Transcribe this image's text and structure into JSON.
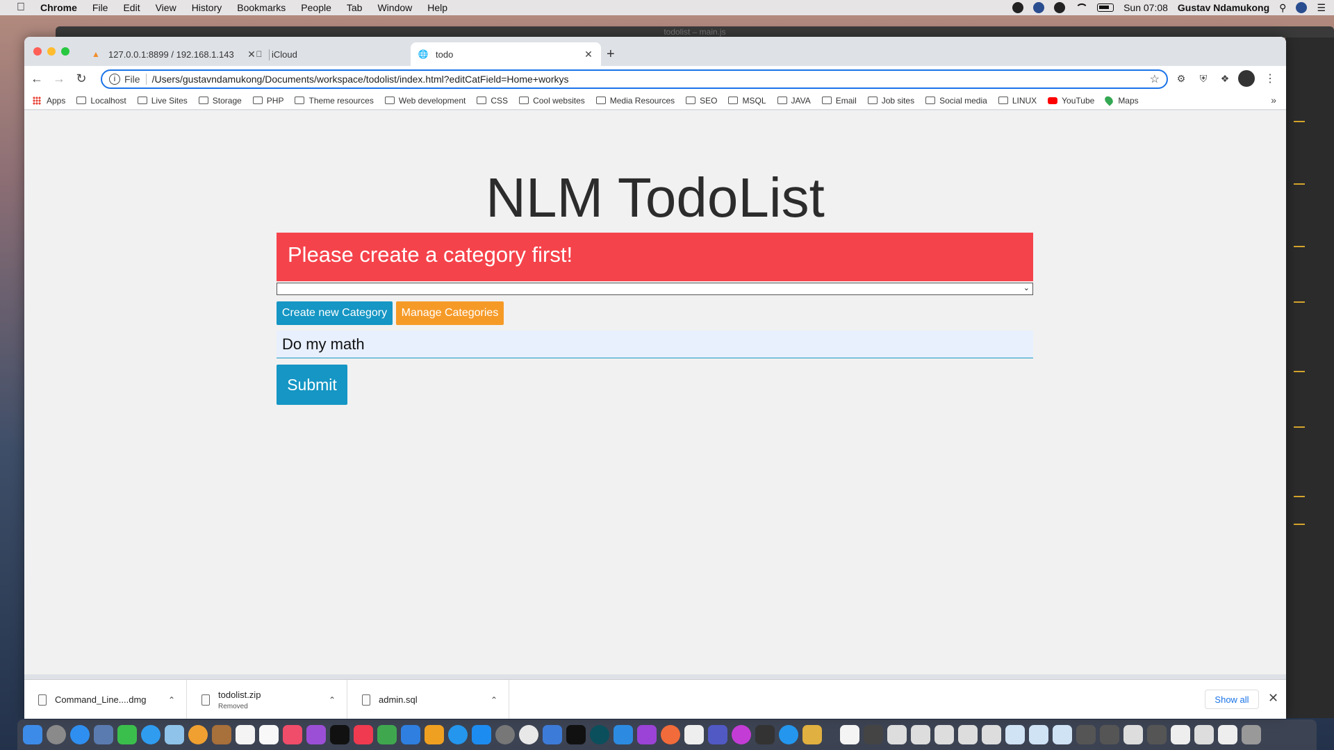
{
  "menubar": {
    "app_name": "Chrome",
    "menus": [
      "File",
      "Edit",
      "View",
      "History",
      "Bookmarks",
      "People",
      "Tab",
      "Window",
      "Help"
    ],
    "clock": "Sun 07:08",
    "user": "Gustav Ndamukong"
  },
  "background_window": {
    "title": "todolist – main.js"
  },
  "browser": {
    "tabs": [
      {
        "title": "127.0.0.1:8899 / 192.168.1.143",
        "icon": "phpmyadmin-icon"
      },
      {
        "title": "iCloud",
        "icon": "apple-icon"
      },
      {
        "title": "todo",
        "icon": "globe-icon",
        "active": true
      }
    ],
    "address": {
      "scheme_label": "File",
      "url": "/Users/gustavndamukong/Documents/workspace/todolist/index.html?editCatField=Home+workys"
    },
    "bookmarks": [
      {
        "label": "Apps",
        "icon": "apps-grid-icon"
      },
      {
        "label": "Localhost",
        "icon": "folder-icon"
      },
      {
        "label": "Live Sites",
        "icon": "folder-icon"
      },
      {
        "label": "Storage",
        "icon": "folder-icon"
      },
      {
        "label": "PHP",
        "icon": "folder-icon"
      },
      {
        "label": "Theme resources",
        "icon": "folder-icon"
      },
      {
        "label": "Web development",
        "icon": "folder-icon"
      },
      {
        "label": "CSS",
        "icon": "folder-icon"
      },
      {
        "label": "Cool websites",
        "icon": "folder-icon"
      },
      {
        "label": "Media Resources",
        "icon": "folder-icon"
      },
      {
        "label": "SEO",
        "icon": "folder-icon"
      },
      {
        "label": "MSQL",
        "icon": "folder-icon"
      },
      {
        "label": "JAVA",
        "icon": "folder-icon"
      },
      {
        "label": "Email",
        "icon": "folder-icon"
      },
      {
        "label": "Job sites",
        "icon": "folder-icon"
      },
      {
        "label": "Social media",
        "icon": "folder-icon"
      },
      {
        "label": "LINUX",
        "icon": "folder-icon"
      },
      {
        "label": "YouTube",
        "icon": "youtube-icon"
      },
      {
        "label": "Maps",
        "icon": "maps-icon"
      }
    ],
    "more_symbol": "»"
  },
  "page": {
    "title": "NLM TodoList",
    "alert": "Please create a category first!",
    "select_value": "",
    "create_button": "Create new Category",
    "manage_button": "Manage Categories",
    "todo_value": "Do my math",
    "submit_button": "Submit"
  },
  "downloads": {
    "items": [
      {
        "name": "Command_Line....dmg",
        "status": ""
      },
      {
        "name": "todolist.zip",
        "status": "Removed"
      },
      {
        "name": "admin.sql",
        "status": ""
      }
    ],
    "show_all": "Show all"
  },
  "colors": {
    "alert_bg": "#f5434b",
    "primary_button": "#1596c4",
    "warning_button": "#f69a27",
    "page_bg": "#f1f1f1",
    "input_bg": "#e8f0fe"
  }
}
